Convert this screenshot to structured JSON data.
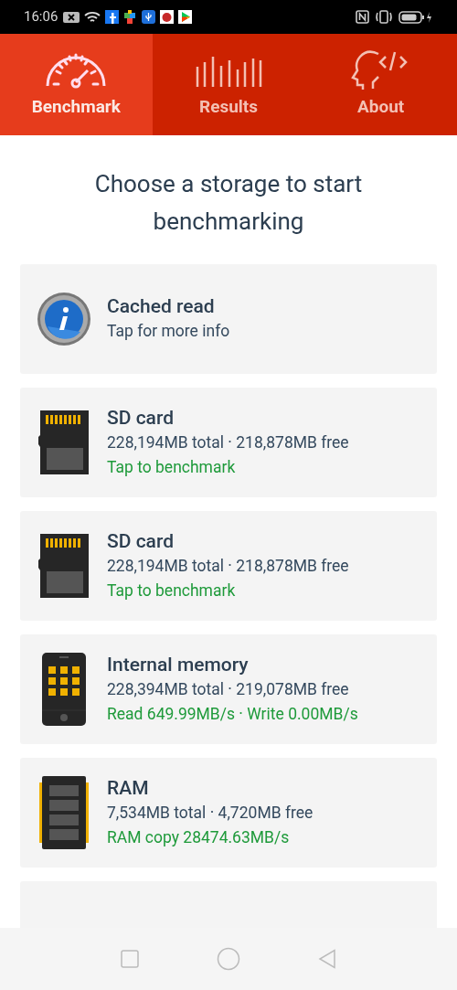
{
  "status_bar": {
    "time": "16:06"
  },
  "tabs": [
    {
      "label": "Benchmark",
      "kind": "gauge",
      "selected": true
    },
    {
      "label": "Results",
      "kind": "bars",
      "selected": false
    },
    {
      "label": "About",
      "kind": "head",
      "selected": false
    }
  ],
  "heading": "Choose a storage to start benchmarking",
  "storages": [
    {
      "kind": "info",
      "title": "Cached read",
      "lines": [
        {
          "text": "Tap for more info",
          "kind": "detail"
        }
      ]
    },
    {
      "kind": "sd",
      "title": "SD card",
      "lines": [
        {
          "text": "228,194MB total · 218,878MB free",
          "kind": "detail"
        },
        {
          "text": "Tap to benchmark",
          "kind": "status"
        }
      ]
    },
    {
      "kind": "sd",
      "title": "SD card",
      "lines": [
        {
          "text": "228,194MB total · 218,878MB free",
          "kind": "detail"
        },
        {
          "text": "Tap to benchmark",
          "kind": "status"
        }
      ]
    },
    {
      "kind": "phone",
      "title": "Internal memory",
      "lines": [
        {
          "text": "228,394MB total · 219,078MB free",
          "kind": "detail"
        },
        {
          "text": "Read 649.99MB/s · Write 0.00MB/s",
          "kind": "status"
        }
      ]
    },
    {
      "kind": "ram",
      "title": "RAM",
      "lines": [
        {
          "text": "7,534MB total · 4,720MB free",
          "kind": "detail"
        },
        {
          "text": "RAM copy 28474.63MB/s",
          "kind": "status"
        }
      ]
    },
    {
      "kind": "partial"
    }
  ]
}
